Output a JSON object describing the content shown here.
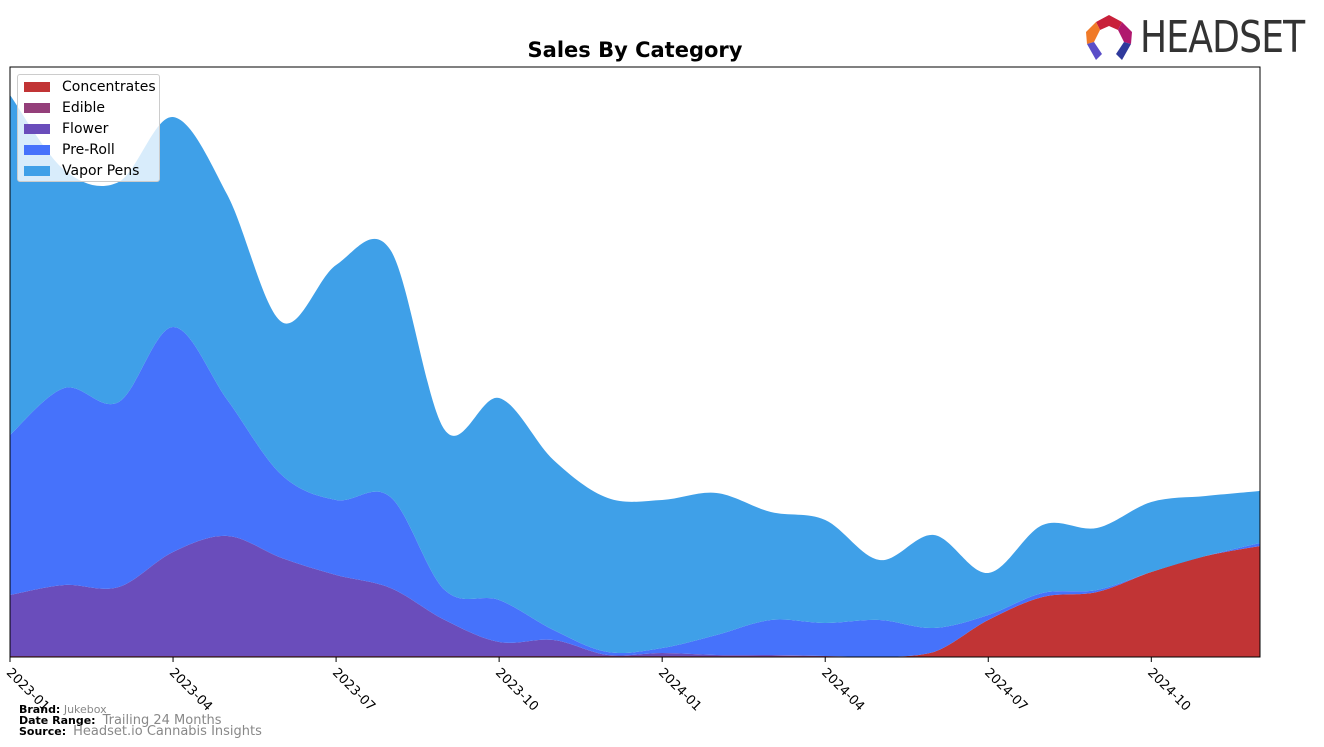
{
  "logo_text": "HEADSET",
  "chart_data": {
    "type": "area",
    "stacked": true,
    "title": "Sales By Category",
    "xlabel": "",
    "ylabel": "",
    "x": [
      "2023-01",
      "2023-02",
      "2023-03",
      "2023-04",
      "2023-05",
      "2023-06",
      "2023-07",
      "2023-08",
      "2023-09",
      "2023-10",
      "2023-11",
      "2023-12",
      "2024-01",
      "2024-02",
      "2024-03",
      "2024-04",
      "2024-05",
      "2024-06",
      "2024-07",
      "2024-08",
      "2024-09",
      "2024-10",
      "2024-11",
      "2024-12"
    ],
    "xticks": [
      "2023-01",
      "2023-04",
      "2023-07",
      "2023-10",
      "2024-01",
      "2024-04",
      "2024-07",
      "2024-10"
    ],
    "ylim": [
      0,
      590
    ],
    "y_axis_visible": false,
    "grid": false,
    "legend_position": "top-left",
    "series": [
      {
        "name": "Concentrates",
        "color": "#c13435",
        "values": [
          0,
          0,
          0,
          0,
          0,
          0,
          0,
          0,
          0,
          0,
          0,
          0,
          0,
          0,
          0,
          0,
          0,
          5,
          37,
          60,
          65,
          85,
          101,
          111
        ]
      },
      {
        "name": "Edible",
        "color": "#943f7a",
        "values": [
          1,
          1,
          1,
          1,
          1,
          1,
          1,
          1,
          1,
          1,
          1,
          1,
          1,
          1,
          1,
          1,
          0,
          0,
          0,
          0,
          0,
          0,
          0,
          0
        ]
      },
      {
        "name": "Flower",
        "color": "#6a4dbb",
        "values": [
          61,
          71,
          69,
          104,
          120,
          98,
          81,
          68,
          36,
          14,
          16,
          1,
          3,
          1,
          1,
          0,
          0,
          0,
          0,
          0,
          0,
          0,
          0,
          0
        ]
      },
      {
        "name": "Pre-Roll",
        "color": "#4672fb",
        "values": [
          160,
          197,
          185,
          225,
          136,
          83,
          75,
          91,
          30,
          42,
          10,
          3,
          5,
          20,
          35,
          33,
          37,
          24,
          5,
          4,
          2,
          0,
          0,
          3
        ]
      },
      {
        "name": "Vapor Pens",
        "color": "#3fa0e8",
        "values": [
          340,
          218,
          220,
          210,
          205,
          153,
          235,
          247,
          160,
          202,
          170,
          154,
          148,
          142,
          108,
          103,
          60,
          93,
          42,
          68,
          62,
          70,
          60,
          52
        ]
      }
    ]
  },
  "footer": {
    "brand_label": "Brand:",
    "brand": "Jukebox",
    "range_label": "Date Range:",
    "range": "Trailing 24 Months",
    "source_label": "Source:",
    "source": "Headset.io Cannabis Insights"
  }
}
